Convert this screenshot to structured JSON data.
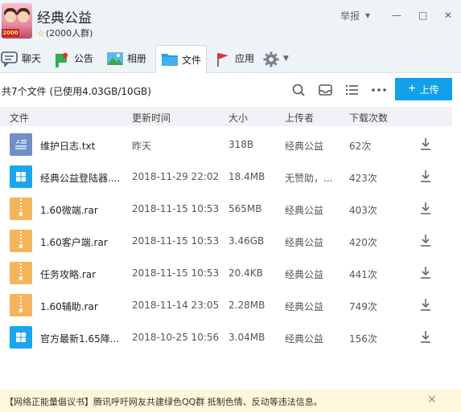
{
  "header": {
    "group_name": "经典公益",
    "member_count": "(2000人群)",
    "avatar_badge": "2000",
    "report_label": "举报",
    "window_controls": [
      "▾",
      "—",
      "□",
      "✕"
    ]
  },
  "nav": {
    "tabs": [
      {
        "label": "聊天",
        "icon": "chat-icon"
      },
      {
        "label": "公告",
        "icon": "announcement-icon"
      },
      {
        "label": "相册",
        "icon": "album-icon"
      },
      {
        "label": "文件",
        "icon": "folder-icon",
        "active": true
      },
      {
        "label": "应用",
        "icon": "apps-flag-icon"
      }
    ],
    "settings_icon": "gear-icon"
  },
  "toolbar": {
    "summary": "共7个文件 (已使用4.03GB/10GB)",
    "upload_label": "上传",
    "icons": [
      "search-icon",
      "inbox-icon",
      "list-view-icon",
      "more-icon"
    ]
  },
  "table": {
    "headers": [
      "文件",
      "更新时间",
      "大小",
      "上传者",
      "下载次数"
    ],
    "rows": [
      {
        "name": "维护日志.txt",
        "time": "昨天",
        "size": "318B",
        "uploader": "经典公益",
        "downloads": "62次",
        "type": "txt"
      },
      {
        "name": "经典公益登陆器....",
        "time": "2018-11-29 22:02",
        "size": "18.4MB",
        "uploader": "无赞助，...",
        "downloads": "423次",
        "type": "exe"
      },
      {
        "name": "1.60微端.rar",
        "time": "2018-11-15 10:53",
        "size": "565MB",
        "uploader": "经典公益",
        "downloads": "403次",
        "type": "rar"
      },
      {
        "name": "1.60客户端.rar",
        "time": "2018-11-15 10:53",
        "size": "3.46GB",
        "uploader": "经典公益",
        "downloads": "420次",
        "type": "rar"
      },
      {
        "name": "任务攻略.rar",
        "time": "2018-11-15 10:53",
        "size": "20.4KB",
        "uploader": "经典公益",
        "downloads": "441次",
        "type": "rar"
      },
      {
        "name": "1.60辅助.rar",
        "time": "2018-11-14 23:05",
        "size": "2.28MB",
        "uploader": "经典公益",
        "downloads": "749次",
        "type": "rar"
      },
      {
        "name": "官方最新1.65降...",
        "time": "2018-10-25 10:56",
        "size": "3.04MB",
        "uploader": "经典公益",
        "downloads": "156次",
        "type": "exe"
      }
    ]
  },
  "notice": {
    "text": "【网络正能量倡议书】腾讯呼吁网友共建绿色QQ群 抵制色情、反动等违法信息。",
    "close": "✕"
  },
  "colors": {
    "accent": "#12a0e8",
    "header_bg": "#eef3f8",
    "table_header_bg": "#f0f2f5",
    "notice_bg": "#fff7d9",
    "rar_icon": "#f5b45a",
    "txt_icon": "#6e8fc9",
    "exe_icon": "#1aa6ee"
  }
}
